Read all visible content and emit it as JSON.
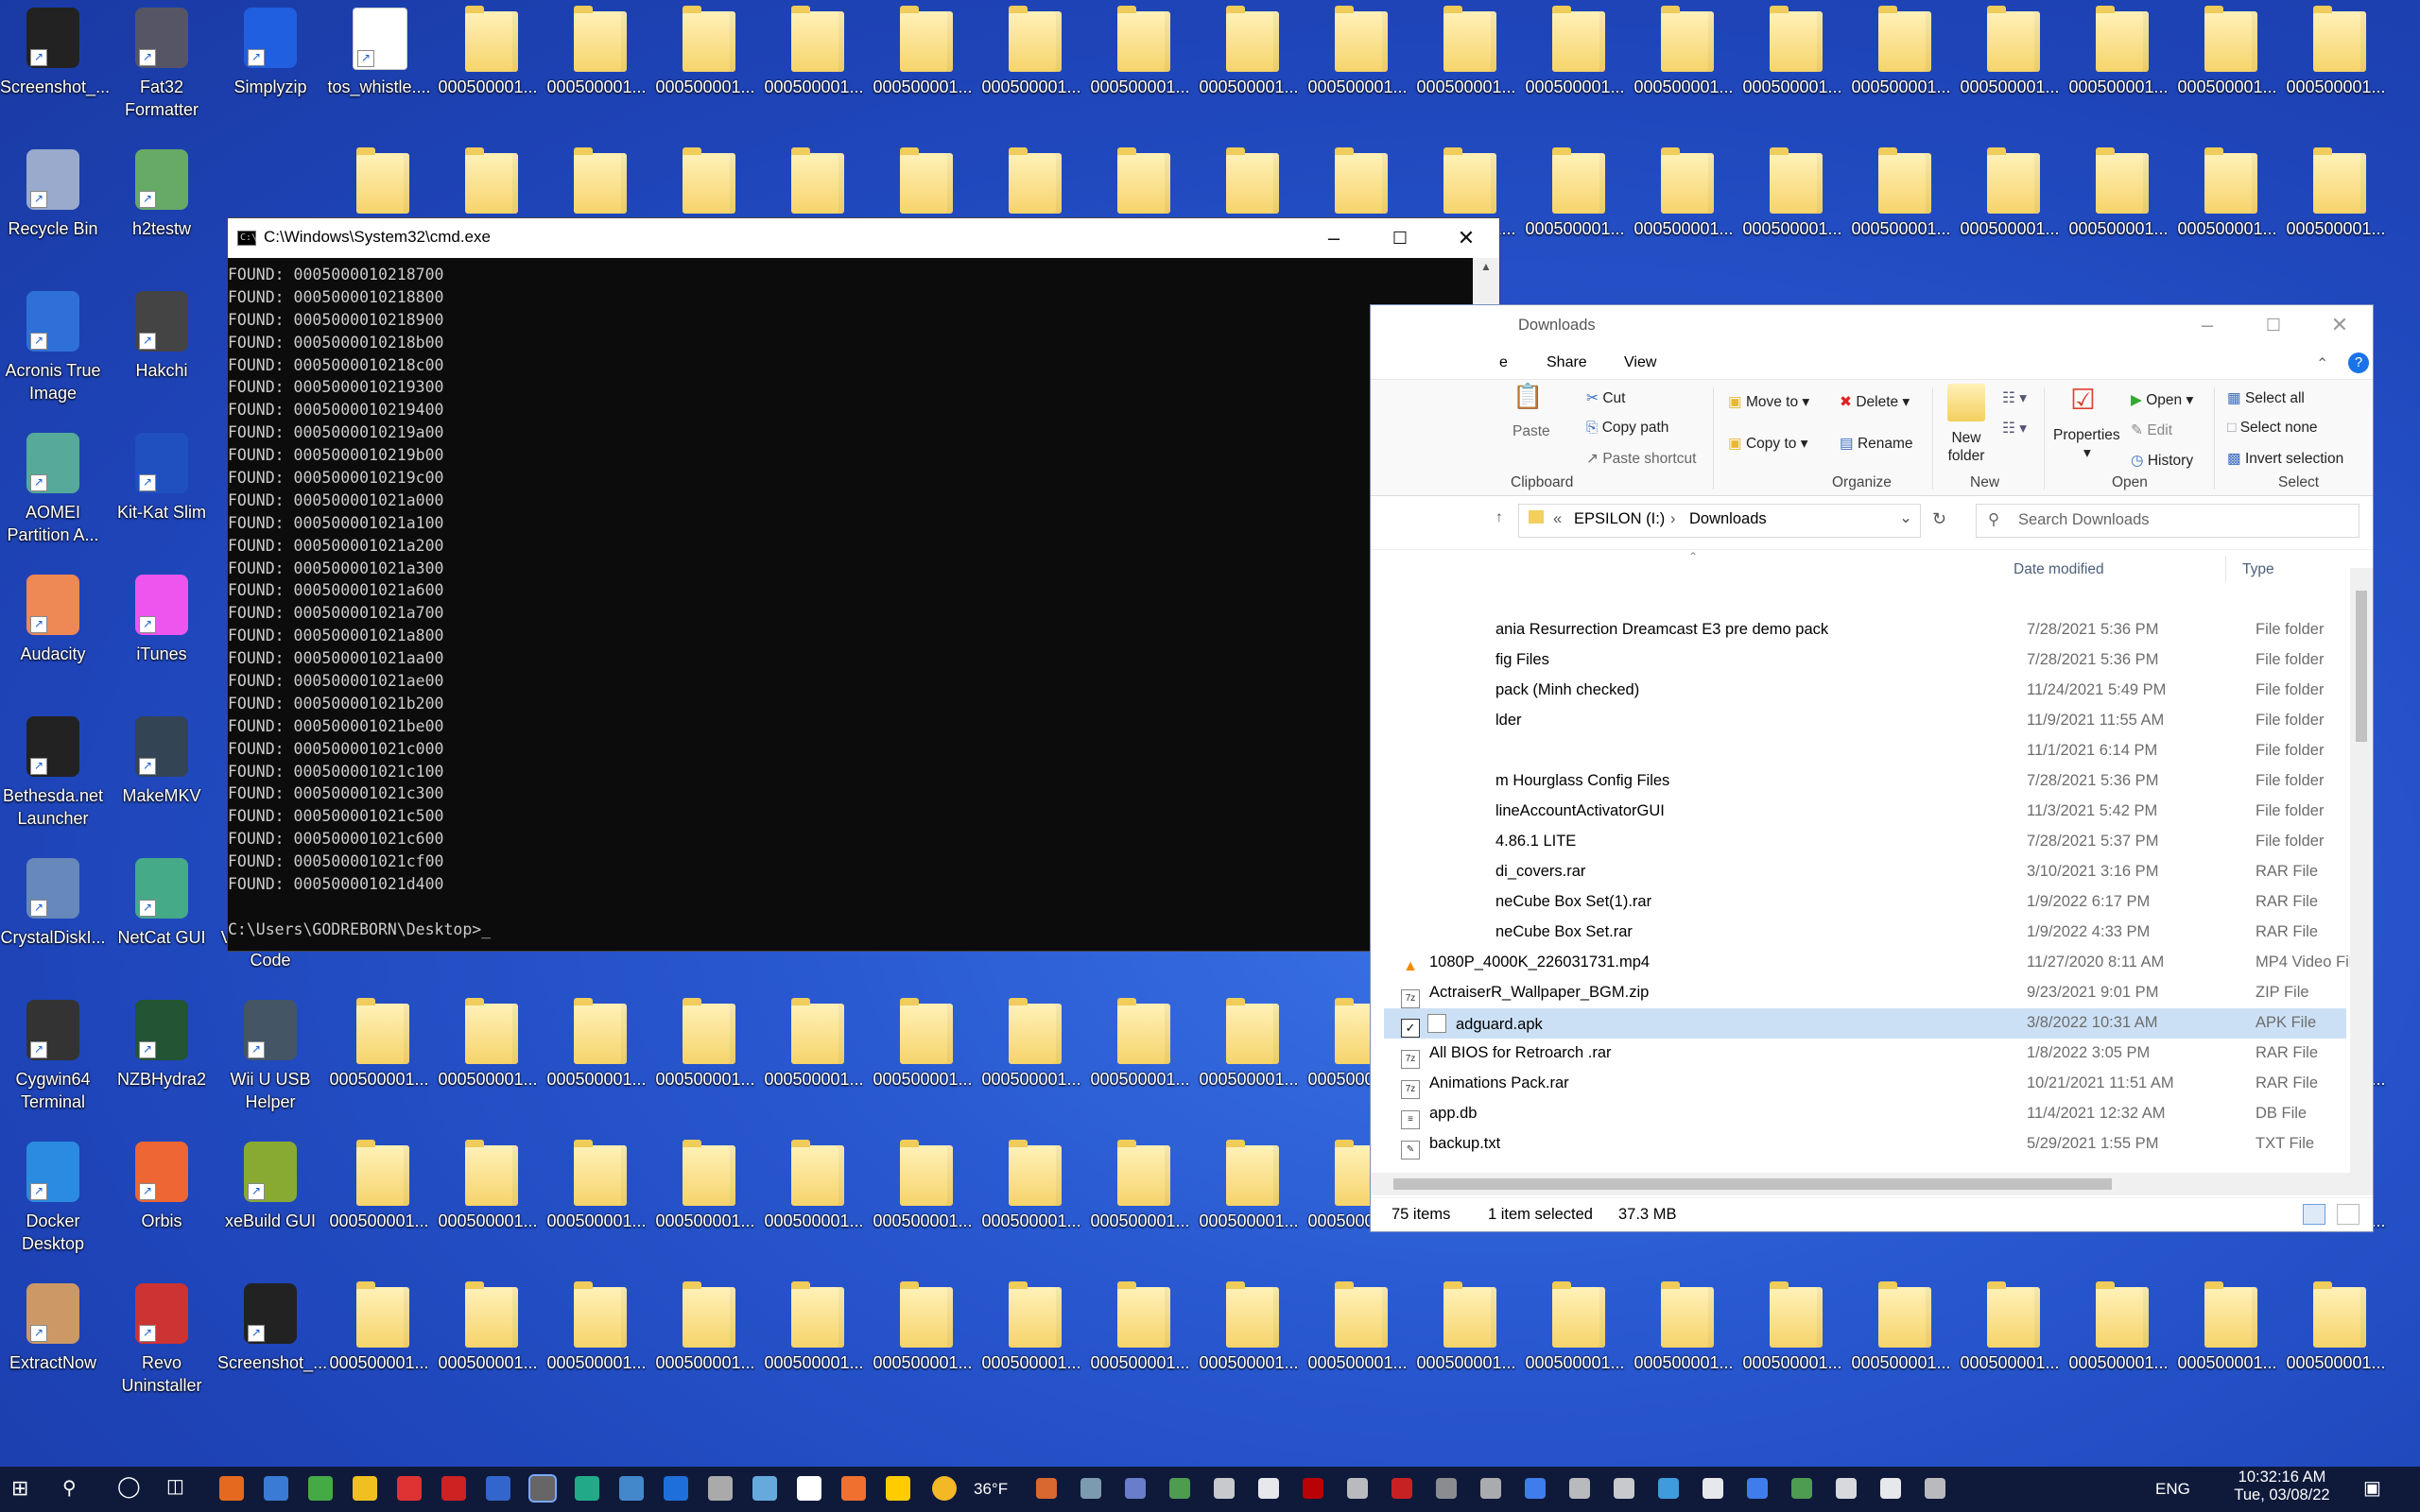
{
  "desktop": {
    "icons": [
      {
        "label": "Screenshot_...",
        "type": "app",
        "color": "#222"
      },
      {
        "label": "Fat32 Formatter",
        "type": "app",
        "color": "#556"
      },
      {
        "label": "Simplyzip",
        "type": "app",
        "color": "#1f5fe0"
      },
      {
        "label": "tos_whistle....",
        "type": "file",
        "color": "#fff"
      },
      {
        "label": "Recycle Bin",
        "type": "app",
        "color": "#9ac"
      },
      {
        "label": "h2testw",
        "type": "app",
        "color": "#6a6"
      },
      {
        "label": "Acronis True Image",
        "type": "app",
        "color": "#2f6fd8"
      },
      {
        "label": "Hakchi",
        "type": "app",
        "color": "#444"
      },
      {
        "label": "AOMEI Partition A...",
        "type": "app",
        "color": "#5a9"
      },
      {
        "label": "Kit-Kat Slim",
        "type": "app",
        "color": "#2050c0"
      },
      {
        "label": "Audacity",
        "type": "app",
        "color": "#e85"
      },
      {
        "label": "iTunes",
        "type": "app",
        "color": "#e5e"
      },
      {
        "label": "Bethesda.net Launcher",
        "type": "app",
        "color": "#222"
      },
      {
        "label": "MakeMKV",
        "type": "app",
        "color": "#345"
      },
      {
        "label": "CrystalDiskI...",
        "type": "app",
        "color": "#68b"
      },
      {
        "label": "NetCat GUI",
        "type": "app",
        "color": "#4a8"
      },
      {
        "label": "Visual Studio Code",
        "type": "app",
        "color": "#23a"
      },
      {
        "label": "Cygwin64 Terminal",
        "type": "app",
        "color": "#333"
      },
      {
        "label": "NZBHydra2",
        "type": "app",
        "color": "#253"
      },
      {
        "label": "Wii U USB Helper",
        "type": "app",
        "color": "#456"
      },
      {
        "label": "Docker Desktop",
        "type": "app",
        "color": "#2a8be0"
      },
      {
        "label": "Orbis",
        "type": "app",
        "color": "#e63"
      },
      {
        "label": "xeBuild GUI",
        "type": "app",
        "color": "#8a3"
      },
      {
        "label": "ExtractNow",
        "type": "app",
        "color": "#c96"
      },
      {
        "label": "Revo Uninstaller",
        "type": "app",
        "color": "#c33"
      },
      {
        "label": "Screenshot_...",
        "type": "app",
        "color": "#222"
      }
    ],
    "folder_label": "000500001..."
  },
  "cmd": {
    "title": "C:\\Windows\\System32\\cmd.exe",
    "lines": [
      "FOUND: 0005000010218700",
      "FOUND: 0005000010218800",
      "FOUND: 0005000010218900",
      "FOUND: 0005000010218b00",
      "FOUND: 0005000010218c00",
      "FOUND: 0005000010219300",
      "FOUND: 0005000010219400",
      "FOUND: 0005000010219a00",
      "FOUND: 0005000010219b00",
      "FOUND: 0005000010219c00",
      "FOUND: 000500001021a000",
      "FOUND: 000500001021a100",
      "FOUND: 000500001021a200",
      "FOUND: 000500001021a300",
      "FOUND: 000500001021a600",
      "FOUND: 000500001021a700",
      "FOUND: 000500001021a800",
      "FOUND: 000500001021aa00",
      "FOUND: 000500001021ae00",
      "FOUND: 000500001021b200",
      "FOUND: 000500001021be00",
      "FOUND: 000500001021c000",
      "FOUND: 000500001021c100",
      "FOUND: 000500001021c300",
      "FOUND: 000500001021c500",
      "FOUND: 000500001021c600",
      "FOUND: 000500001021cf00",
      "FOUND: 000500001021d400",
      "",
      "C:\\Users\\GODREBORN\\Desktop>_"
    ]
  },
  "explorer": {
    "title": "Downloads",
    "tabs": [
      "Share",
      "View"
    ],
    "ribbon": {
      "clipboard": {
        "paste": "Paste",
        "cut": "Cut",
        "copy_path": "Copy path",
        "paste_shortcut": "Paste shortcut",
        "group": "Clipboard"
      },
      "organize": {
        "move_to": "Move to",
        "copy_to": "Copy to",
        "delete": "Delete",
        "rename": "Rename",
        "group": "Organize"
      },
      "new": {
        "new_folder": "New folder",
        "group": "New"
      },
      "open": {
        "properties": "Properties",
        "open": "Open",
        "edit": "Edit",
        "history": "History",
        "group": "Open"
      },
      "select": {
        "select_all": "Select all",
        "select_none": "Select none",
        "invert": "Invert selection",
        "group": "Select"
      }
    },
    "address": {
      "drive": "EPSILON (I:)",
      "folder": "Downloads",
      "prefix": "«"
    },
    "search_placeholder": "Search Downloads",
    "columns": {
      "date": "Date modified",
      "type": "Type"
    },
    "rows": [
      {
        "name": "ania Resurrection Dreamcast E3 pre demo pack",
        "date": "7/28/2021 5:36 PM",
        "type": "File folder",
        "icon": ""
      },
      {
        "name": "fig Files",
        "date": "7/28/2021 5:36 PM",
        "type": "File folder",
        "icon": ""
      },
      {
        "name": "pack (Minh checked)",
        "date": "11/24/2021 5:49 PM",
        "type": "File folder",
        "icon": ""
      },
      {
        "name": "lder",
        "date": "11/9/2021 11:55 AM",
        "type": "File folder",
        "icon": ""
      },
      {
        "name": "",
        "date": "11/1/2021 6:14 PM",
        "type": "File folder",
        "icon": ""
      },
      {
        "name": "m Hourglass Config Files",
        "date": "7/28/2021 5:36 PM",
        "type": "File folder",
        "icon": ""
      },
      {
        "name": "lineAccountActivatorGUI",
        "date": "11/3/2021 5:42 PM",
        "type": "File folder",
        "icon": ""
      },
      {
        "name": "4.86.1 LITE",
        "date": "7/28/2021 5:37 PM",
        "type": "File folder",
        "icon": ""
      },
      {
        "name": "di_covers.rar",
        "date": "3/10/2021 3:16 PM",
        "type": "RAR File",
        "icon": ""
      },
      {
        "name": "neCube Box Set(1).rar",
        "date": "1/9/2022 6:17 PM",
        "type": "RAR File",
        "icon": ""
      },
      {
        "name": "neCube Box Set.rar",
        "date": "1/9/2022 4:33 PM",
        "type": "RAR File",
        "icon": ""
      },
      {
        "name": "1080P_4000K_226031731.mp4",
        "date": "11/27/2020 8:11 AM",
        "type": "MP4 Video File",
        "icon": "▲"
      },
      {
        "name": "ActraiserR_Wallpaper_BGM.zip",
        "date": "9/23/2021 9:01 PM",
        "type": "ZIP File",
        "icon": "7z"
      },
      {
        "name": "adguard.apk",
        "date": "3/8/2022 10:31 AM",
        "type": "APK File",
        "icon": "",
        "selected": true
      },
      {
        "name": "All BIOS for Retroarch .rar",
        "date": "1/8/2022 3:05 PM",
        "type": "RAR File",
        "icon": "7z"
      },
      {
        "name": "Animations Pack.rar",
        "date": "10/21/2021 11:51 AM",
        "type": "RAR File",
        "icon": "7z"
      },
      {
        "name": "app.db",
        "date": "11/4/2021 12:32 AM",
        "type": "DB File",
        "icon": "≡"
      },
      {
        "name": "backup.txt",
        "date": "5/29/2021 1:55 PM",
        "type": "TXT File",
        "icon": "✎"
      }
    ],
    "status": {
      "items": "75 items",
      "selected": "1 item selected",
      "size": "37.3 MB"
    }
  },
  "taskbar": {
    "weather": "36°F",
    "lang": "ENG",
    "time": "10:32:16 AM",
    "date": "Tue, 03/08/22"
  }
}
